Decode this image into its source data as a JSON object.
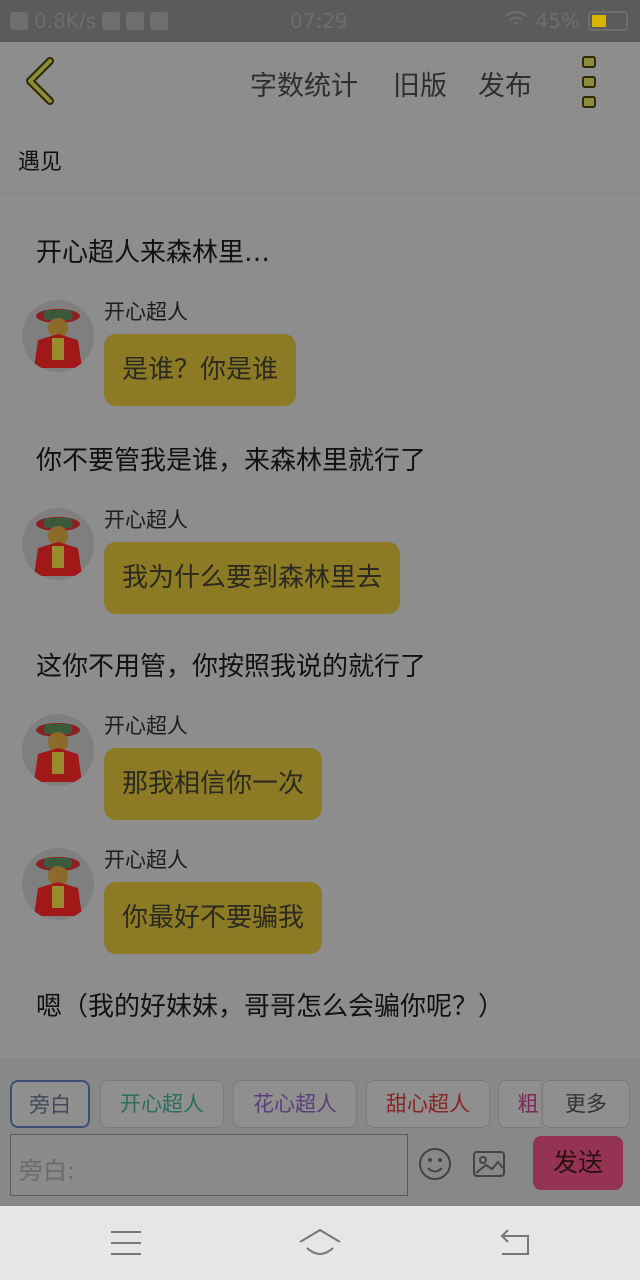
{
  "status_bar": {
    "speed": "0.8K/s",
    "time": "07:29",
    "battery_percent": "45%",
    "battery_level": 0.45
  },
  "header": {
    "links": [
      "字数统计",
      "旧版",
      "发布"
    ]
  },
  "title": "遇见",
  "messages": [
    {
      "type": "narration",
      "text": "开心超人来森林里…"
    },
    {
      "type": "dialog",
      "speaker": "开心超人",
      "text": "是谁？你是谁"
    },
    {
      "type": "narration",
      "text": "你不要管我是谁，来森林里就行了"
    },
    {
      "type": "dialog",
      "speaker": "开心超人",
      "text": "我为什么要到森林里去"
    },
    {
      "type": "narration",
      "text": "这你不用管，你按照我说的就行了"
    },
    {
      "type": "dialog",
      "speaker": "开心超人",
      "text": "那我相信你一次"
    },
    {
      "type": "dialog",
      "speaker": "开心超人",
      "text": "你最好不要骗我"
    },
    {
      "type": "narration",
      "text": "嗯（我的好妹妹，哥哥怎么会骗你呢？）"
    }
  ],
  "roles": [
    {
      "label": "旁白",
      "color": "#44495a"
    },
    {
      "label": "开心超人",
      "color": "#2c6d5e"
    },
    {
      "label": "花心超人",
      "color": "#5b3f7a"
    },
    {
      "label": "甜心超人",
      "color": "#8b2323"
    },
    {
      "label": "粗",
      "color": "#7a2a55"
    }
  ],
  "more_label": "更多",
  "input": {
    "placeholder": "旁白:"
  },
  "send_label": "发送",
  "icons": [
    "back-icon",
    "more-vertical-icon",
    "emoji-icon",
    "image-icon",
    "menu-icon",
    "home-icon",
    "back-nav-icon"
  ]
}
